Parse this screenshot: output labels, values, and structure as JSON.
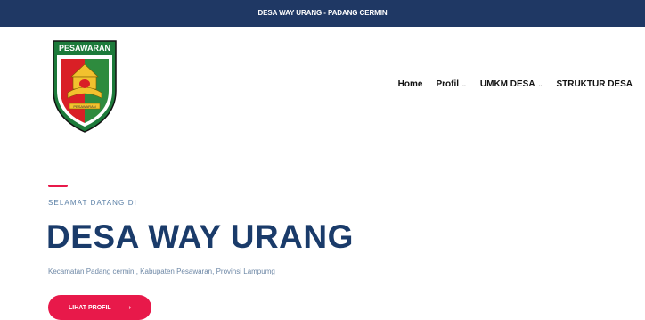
{
  "topbar": {
    "title": "DESA WAY URANG - PADANG CERMIN"
  },
  "logo": {
    "text": "PESAWARAN",
    "ribbon": "PESAWARAN"
  },
  "nav": {
    "items": [
      {
        "label": "Home",
        "has_dropdown": false
      },
      {
        "label": "Profil",
        "has_dropdown": true
      },
      {
        "label": "UMKM DESA",
        "has_dropdown": true
      },
      {
        "label": "STRUKTUR DESA",
        "has_dropdown": false
      }
    ]
  },
  "hero": {
    "eyebrow": "SELAMAT DATANG DI",
    "title": "DESA WAY URANG",
    "subtitle": "Kecamatan Padang cermin , Kabupaten Pesawaran, Provinsi Lampumg",
    "cta_label": "LIHAT PROFIL",
    "cta_arrow": "›"
  },
  "colors": {
    "topbar": "#1f3864",
    "accent": "#e8194a",
    "headline": "#1a3b6a"
  }
}
